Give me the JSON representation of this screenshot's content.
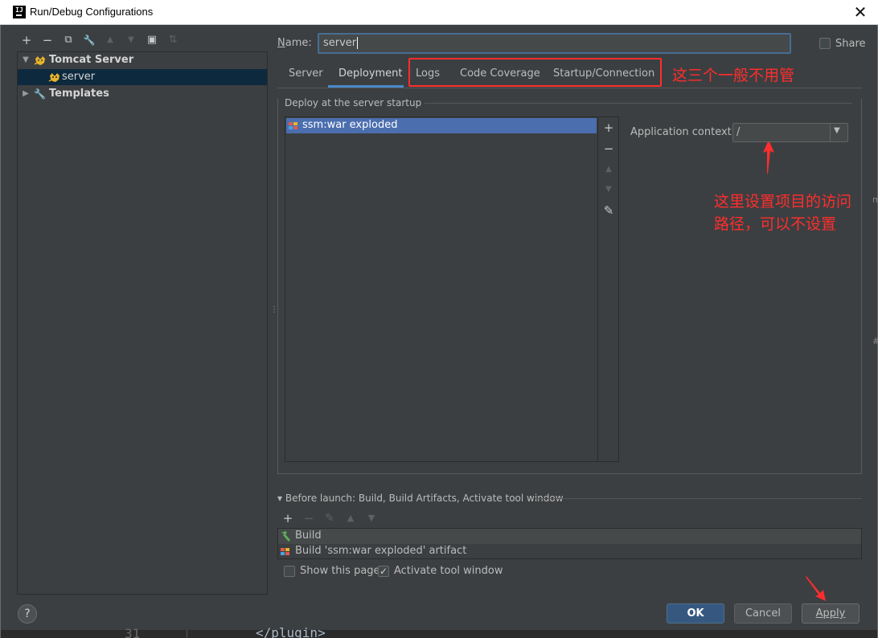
{
  "window": {
    "title": "Run/Debug Configurations",
    "app_icon_letter": "IJ",
    "close_symbol": "✕"
  },
  "toolbar": {
    "icons": [
      "add-icon",
      "remove-icon",
      "copy-icon",
      "wrench-icon",
      "move-up-icon",
      "move-down-icon",
      "folder-add-icon",
      "sort-icon"
    ],
    "add": "+",
    "remove": "−",
    "copy": "⧉",
    "wrench": "🔧",
    "up": "▲",
    "down": "▼",
    "folder": "▣",
    "sort": "⇅"
  },
  "tree": {
    "group_label": "Tomcat Server",
    "item_label": "server",
    "templates_label": "Templates",
    "expanded_arrow": "▼",
    "collapsed_arrow": "▶",
    "wrench_glyph": "🔧"
  },
  "name_field": {
    "label": "Name:",
    "value": "server"
  },
  "share": {
    "label": "Share",
    "checked": false
  },
  "tabs": [
    {
      "label": "Server",
      "active": false
    },
    {
      "label": "Deployment",
      "active": true
    },
    {
      "label": "Logs",
      "active": false
    },
    {
      "label": "Code Coverage",
      "active": false
    },
    {
      "label": "Startup/Connection",
      "active": false
    }
  ],
  "annotations": {
    "tabs_note": "这三个一般不用管",
    "context_note_line1": "这里设置项目的访问",
    "context_note_line2": "路径，可以不设置",
    "color": "#ff2d2d"
  },
  "deployment": {
    "group_title": "Deploy at the server startup",
    "artifacts": [
      "ssm:war exploded"
    ],
    "list_tools": {
      "add": "+",
      "remove": "−",
      "up": "▲",
      "down": "▼",
      "edit": "✎"
    },
    "context_label": "Application context:",
    "context_value": "/",
    "combo_arrow": "▼"
  },
  "before_launch": {
    "title": "Before launch: Build, Build Artifacts, Activate tool window",
    "expander": "▾",
    "tools": {
      "add": "+",
      "remove": "−",
      "edit": "✎",
      "up": "▲",
      "down": "▼"
    },
    "items": [
      "Build",
      "Build 'ssm:war exploded' artifact"
    ],
    "show_page_label": "Show this page",
    "show_page_checked": false,
    "activate_label": "Activate tool window",
    "activate_checked": true,
    "check_mark": "✓"
  },
  "buttons": {
    "help": "?",
    "ok": "OK",
    "cancel": "Cancel",
    "apply": "Apply"
  },
  "editor_behind": {
    "line_number": "31",
    "code": "</plugin>"
  },
  "colors": {
    "accent": "#4a88c7",
    "selection": "#4b6eaf",
    "ok_button": "#365880",
    "background": "#3c3f41"
  }
}
